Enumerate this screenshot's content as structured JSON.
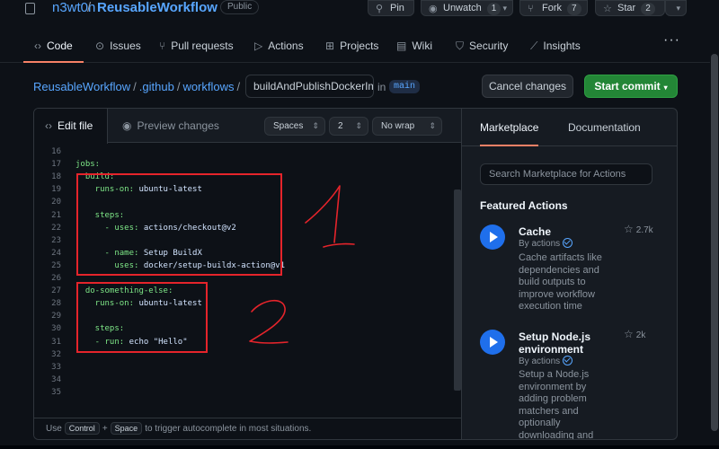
{
  "repo": {
    "owner": "n3wt0n",
    "separator": "/",
    "name": "ReusableWorkflow",
    "visibility": "Public"
  },
  "header_buttons": {
    "pin": {
      "label": "Pin",
      "icon": "pin-icon"
    },
    "unwatch": {
      "label": "Unwatch",
      "count": "1",
      "icon": "eye-icon"
    },
    "fork": {
      "label": "Fork",
      "count": "7",
      "icon": "fork-icon"
    },
    "star": {
      "label": "Star",
      "count": "2",
      "icon": "star-icon"
    }
  },
  "tabs": [
    {
      "label": "Code",
      "icon": "code-icon",
      "glyph": "‹›"
    },
    {
      "label": "Issues",
      "icon": "issue-icon",
      "glyph": "⊙"
    },
    {
      "label": "Pull requests",
      "icon": "pull-request-icon",
      "glyph": "⑂"
    },
    {
      "label": "Actions",
      "icon": "play-icon",
      "glyph": "▷"
    },
    {
      "label": "Projects",
      "icon": "table-icon",
      "glyph": "⊞"
    },
    {
      "label": "Wiki",
      "icon": "book-icon",
      "glyph": "▤"
    },
    {
      "label": "Security",
      "icon": "shield-icon",
      "glyph": "⛉"
    },
    {
      "label": "Insights",
      "icon": "graph-icon",
      "glyph": "⟋"
    }
  ],
  "more_glyph": "···",
  "breadcrumb": {
    "items": [
      "ReusableWorkflow",
      ".github",
      "workflows"
    ],
    "separator": "/",
    "filename": "buildAndPublishDockerIm",
    "in_text": "in",
    "branch": "main"
  },
  "actions": {
    "cancel": "Cancel changes",
    "commit": "Start commit",
    "commit_caret": "▾"
  },
  "editor": {
    "tab_edit": "Edit file",
    "tab_preview": "Preview changes",
    "indent_mode": "Spaces",
    "indent_size": "2",
    "wrap_mode": "No wrap",
    "lines": [
      {
        "n": "16",
        "key": "",
        "val": ""
      },
      {
        "n": "17",
        "key": "jobs:",
        "val": ""
      },
      {
        "n": "18",
        "key": "  build:",
        "val": ""
      },
      {
        "n": "19",
        "key": "    runs-on:",
        "val": " ubuntu-latest"
      },
      {
        "n": "20",
        "key": "",
        "val": ""
      },
      {
        "n": "21",
        "key": "    steps:",
        "val": ""
      },
      {
        "n": "22",
        "key": "      - uses:",
        "val": " actions/checkout@v2"
      },
      {
        "n": "23",
        "key": "",
        "val": ""
      },
      {
        "n": "24",
        "key": "      - name:",
        "val": " Setup BuildX"
      },
      {
        "n": "25",
        "key": "        uses:",
        "val": " docker/setup-buildx-action@v1"
      },
      {
        "n": "26",
        "key": "",
        "val": ""
      },
      {
        "n": "27",
        "key": "  do-something-else:",
        "val": ""
      },
      {
        "n": "28",
        "key": "    runs-on:",
        "val": " ubuntu-latest"
      },
      {
        "n": "29",
        "key": "",
        "val": ""
      },
      {
        "n": "30",
        "key": "    steps:",
        "val": ""
      },
      {
        "n": "31",
        "key": "    - run:",
        "val": " echo \"Hello\""
      },
      {
        "n": "32",
        "key": "",
        "val": ""
      },
      {
        "n": "33",
        "key": "",
        "val": ""
      },
      {
        "n": "34",
        "key": "",
        "val": ""
      },
      {
        "n": "35",
        "key": "",
        "val": ""
      }
    ],
    "footer_pre": "Use",
    "footer_key1": "Control",
    "footer_plus": "+",
    "footer_key2": "Space",
    "footer_post": "to trigger autocomplete in most situations."
  },
  "annotations": {
    "color": "#e5242b",
    "labels": [
      "1",
      "2"
    ]
  },
  "sidebar": {
    "tab_marketplace": "Marketplace",
    "tab_documentation": "Documentation",
    "search_placeholder": "Search Marketplace for Actions",
    "featured_title": "Featured Actions",
    "items": [
      {
        "name": "Cache",
        "by": "By actions",
        "description": "Cache artifacts like dependencies and build outputs to improve workflow execution time",
        "stars": "2.7k"
      },
      {
        "name": "Setup Node.js environment",
        "by": "By actions",
        "description": "Setup a Node.js environment by adding problem matchers and optionally downloading and",
        "stars": "2k"
      }
    ]
  },
  "colors": {
    "background": "#0d1117",
    "link": "#58a6ff",
    "primary_button": "#238636",
    "active_tab": "#f78166"
  }
}
